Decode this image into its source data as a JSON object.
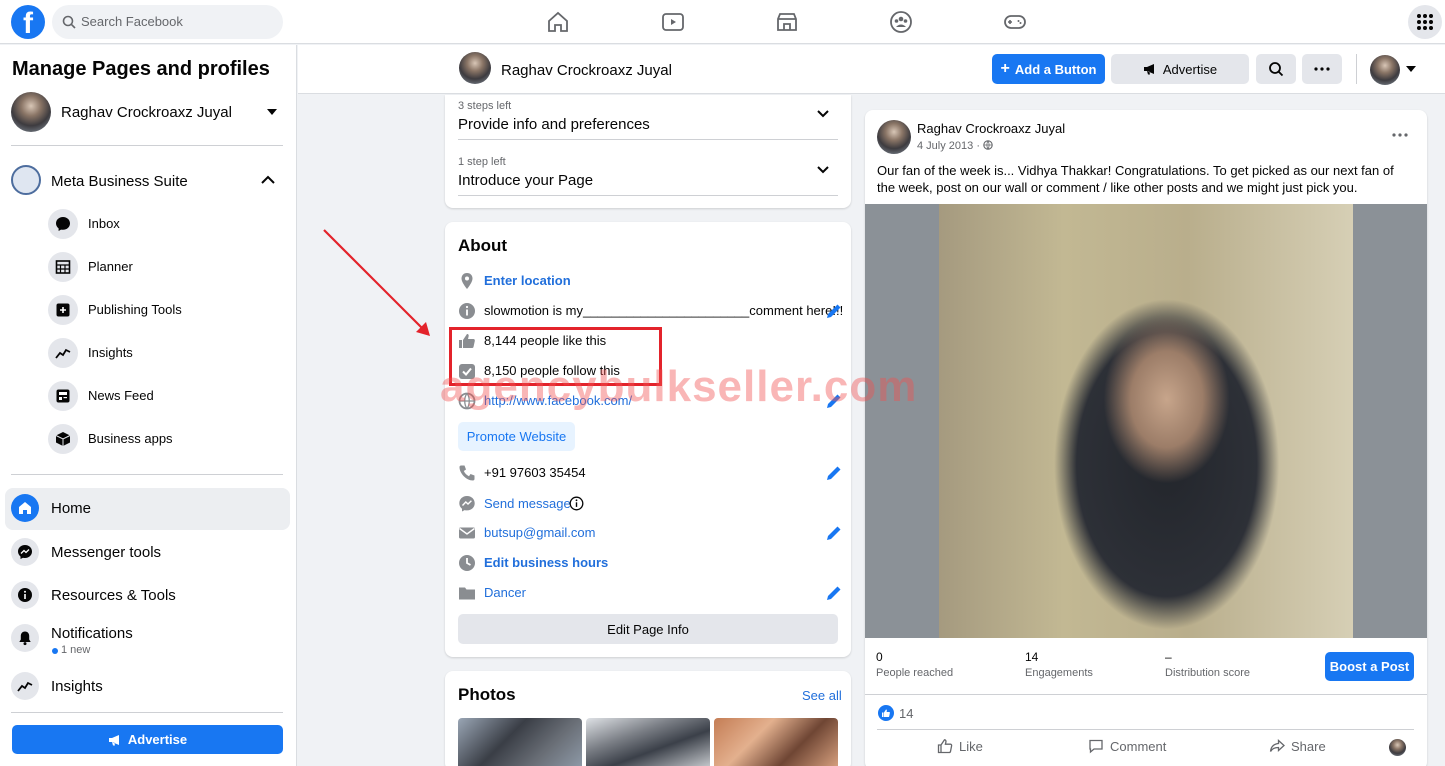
{
  "topbar": {
    "logo": "f",
    "search_placeholder": "Search Facebook",
    "nav_icons": [
      "home-icon",
      "watch-icon",
      "marketplace-icon",
      "groups-icon",
      "gaming-icon"
    ],
    "menu_icon": "grid-menu-icon"
  },
  "sidebar": {
    "title": "Manage Pages and profiles",
    "profile_name": "Raghav Crockroaxz Juyal",
    "suite": "Meta Business Suite",
    "suite_items": [
      {
        "label": "Inbox",
        "icon": "inbox-icon"
      },
      {
        "label": "Planner",
        "icon": "planner-icon"
      },
      {
        "label": "Publishing Tools",
        "icon": "publishing-tools-icon"
      },
      {
        "label": "Insights",
        "icon": "insights-icon"
      },
      {
        "label": "News Feed",
        "icon": "news-feed-icon"
      },
      {
        "label": "Business apps",
        "icon": "business-apps-icon"
      }
    ],
    "main_items": [
      {
        "label": "Home",
        "icon": "home-icon"
      },
      {
        "label": "Messenger tools",
        "icon": "messenger-icon"
      },
      {
        "label": "Resources & Tools",
        "icon": "info-icon"
      },
      {
        "label": "Notifications",
        "icon": "bell-icon"
      },
      {
        "label": "Insights",
        "icon": "insights-icon"
      }
    ],
    "notifications_new": "1 new",
    "advertise_label": "Advertise"
  },
  "page_header": {
    "name": "Raghav Crockroaxz Juyal",
    "add_button": "Add a Button",
    "advertise": "Advertise"
  },
  "steps": [
    {
      "count": "3 steps left",
      "title": "Provide info and preferences"
    },
    {
      "count": "1 step left",
      "title": "Introduce your Page"
    }
  ],
  "about": {
    "title": "About",
    "location": "Enter location",
    "description": "slowmotion is my_______________________comment here!!!",
    "likes": "8,144 people like this",
    "follows": "8,150 people follow this",
    "website": "http://www.facebook.com/",
    "promote": "Promote Website",
    "phone": "+91 97603 35454",
    "message": "Send message",
    "email": "butsup@gmail.com",
    "hours": "Edit business hours",
    "category": "Dancer",
    "edit_button": "Edit Page Info"
  },
  "photos": {
    "title": "Photos",
    "see_all": "See all"
  },
  "watermark": "agencybulkseller.com",
  "post": {
    "author": "Raghav Crockroaxz Juyal",
    "date": "4 July 2013 ·",
    "text": "Our fan of the week is... Vidhya Thakkar! Congratulations. To get picked as our next fan of the week, post on our wall or comment / like other posts and we might just pick you.",
    "stats": [
      {
        "value": "0",
        "label": "People reached"
      },
      {
        "value": "14",
        "label": "Engagements"
      },
      {
        "value": "–",
        "label": "Distribution score"
      }
    ],
    "boost": "Boost a Post",
    "reactions": "14",
    "actions": {
      "like": "Like",
      "comment": "Comment",
      "share": "Share"
    }
  },
  "colors": {
    "accent": "#1877f2",
    "highlight": "#e3232b",
    "link": "#216fdb"
  }
}
